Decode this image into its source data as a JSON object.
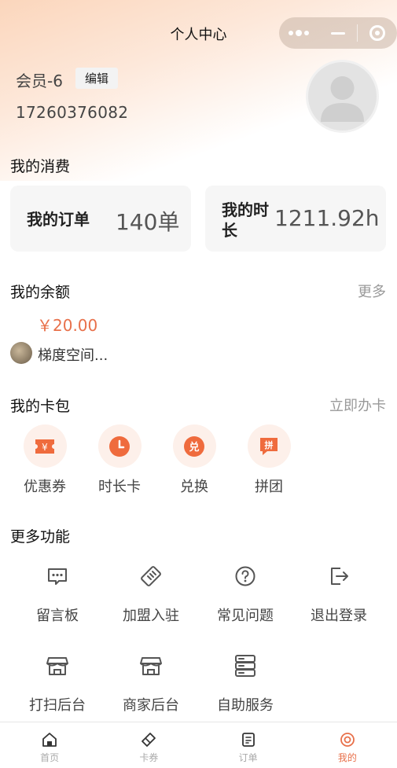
{
  "header": {
    "title": "个人中心"
  },
  "profile": {
    "name": "会员-6",
    "edit_label": "编辑",
    "phone": "17260376082"
  },
  "consumption": {
    "title": "我的消费",
    "orders_label": "我的订单",
    "orders_value": "140单",
    "duration_label_1": "我的时",
    "duration_label_2": "长",
    "duration_value": "1211.92h"
  },
  "balance": {
    "title": "我的余额",
    "more_label": "更多",
    "amount": "￥20.00",
    "store_name": "梯度空间..."
  },
  "wallet": {
    "title": "我的卡包",
    "action_label": "立即办卡",
    "items": [
      {
        "label": "优惠券",
        "icon": "coupon-icon"
      },
      {
        "label": "时长卡",
        "icon": "clock-icon"
      },
      {
        "label": "兑换",
        "icon": "exchange-icon"
      },
      {
        "label": "拼团",
        "icon": "group-buy-icon"
      }
    ]
  },
  "more": {
    "title": "更多功能",
    "items": [
      {
        "label": "留言板",
        "icon": "message-board-icon"
      },
      {
        "label": "加盟入驻",
        "icon": "handshake-icon"
      },
      {
        "label": "常见问题",
        "icon": "question-icon"
      },
      {
        "label": "退出登录",
        "icon": "logout-icon"
      },
      {
        "label": "打扫后台",
        "icon": "cleaning-store-icon"
      },
      {
        "label": "商家后台",
        "icon": "merchant-store-icon"
      },
      {
        "label": "自助服务",
        "icon": "server-icon"
      }
    ]
  },
  "tabs": [
    {
      "label": "首页",
      "icon": "home-icon"
    },
    {
      "label": "卡券",
      "icon": "ticket-icon"
    },
    {
      "label": "订单",
      "icon": "order-icon"
    },
    {
      "label": "我的",
      "icon": "profile-icon"
    }
  ],
  "colors": {
    "accent": "#e8704a",
    "accent_light": "#fdf0ea",
    "card_bg": "#f6f6f6"
  }
}
